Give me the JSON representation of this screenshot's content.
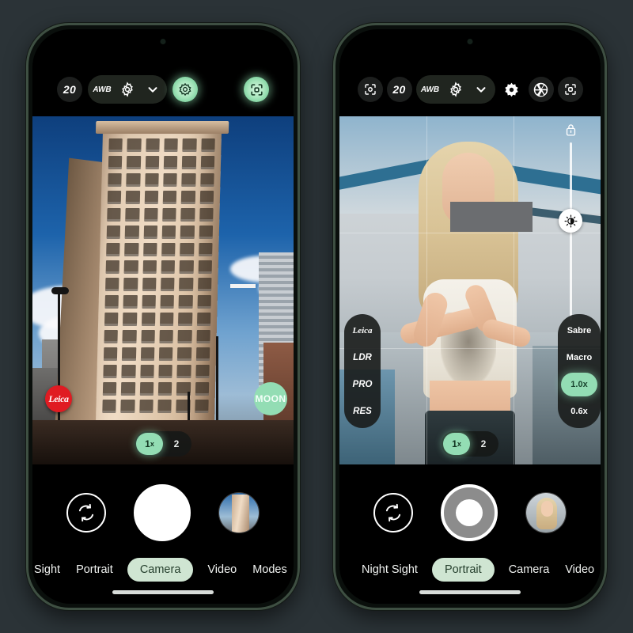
{
  "app": {
    "name": "Camera",
    "accent_green": "#93ddb4",
    "mode_pill_bg": "#cfe5d2",
    "leica_red": "#e01b22",
    "page_bg": "#2b3337",
    "phone_frame": "#3e4f42"
  },
  "phone1": {
    "topbar": [
      {
        "name": "iso-count",
        "label": "20",
        "type": "text-chip"
      },
      {
        "name": "white-balance",
        "label": "AWB",
        "type": "text-chip"
      },
      {
        "name": "settings-gear",
        "label": "",
        "type": "gear-icon"
      },
      {
        "name": "expand-chevron",
        "label": "",
        "type": "chevron-down-icon"
      },
      {
        "name": "filter-active",
        "label": "",
        "type": "flower-icon",
        "active": true
      },
      {
        "name": "scan-focus",
        "label": "",
        "type": "scan-icon",
        "active": true
      }
    ],
    "overlay": {
      "leica_badge": "Leica",
      "moon_badge": "MOON",
      "zoom_options": [
        {
          "label": "1",
          "suffix": "x",
          "active": true
        },
        {
          "label": "2",
          "suffix": "",
          "active": false
        }
      ]
    },
    "shutter": {
      "flip_label": "Flip camera",
      "shutter_label": "Shutter",
      "gallery_label": "Gallery"
    },
    "modes": [
      {
        "label": "Sight",
        "active": false
      },
      {
        "label": "Portrait",
        "active": false
      },
      {
        "label": "Camera",
        "active": true
      },
      {
        "label": "Video",
        "active": false
      },
      {
        "label": "Modes",
        "active": false
      }
    ]
  },
  "phone2": {
    "topbar": [
      {
        "name": "scan-focus-left",
        "label": "",
        "type": "scan-icon"
      },
      {
        "name": "iso-count",
        "label": "20",
        "type": "text-chip"
      },
      {
        "name": "white-balance",
        "label": "AWB",
        "type": "text-chip"
      },
      {
        "name": "settings-gear",
        "label": "",
        "type": "gear-icon"
      },
      {
        "name": "expand-chevron",
        "label": "",
        "type": "chevron-down-icon"
      },
      {
        "name": "filter-flower",
        "label": "",
        "type": "flower-icon"
      },
      {
        "name": "aperture",
        "label": "",
        "type": "aperture-icon"
      },
      {
        "name": "scan-focus-right",
        "label": "",
        "type": "scan-icon"
      }
    ],
    "overlay": {
      "exposure_lock": "AE lock",
      "exposure_label": "Exposure",
      "left_strip": [
        {
          "label": "Leica",
          "type": "logo",
          "active": false
        },
        {
          "label": "LDR",
          "active": false
        },
        {
          "label": "PRO",
          "active": false
        },
        {
          "label": "RES",
          "active": false
        }
      ],
      "right_strip": [
        {
          "label": "Sabre",
          "active": false
        },
        {
          "label": "Macro",
          "active": false
        },
        {
          "label": "1.0x",
          "active": true
        },
        {
          "label": "0.6x",
          "active": false
        }
      ],
      "zoom_options": [
        {
          "label": "1",
          "suffix": "x",
          "active": true
        },
        {
          "label": "2",
          "suffix": "",
          "active": false
        }
      ]
    },
    "shutter": {
      "flip_label": "Flip camera",
      "shutter_label": "Shutter",
      "gallery_label": "Gallery"
    },
    "modes": [
      {
        "label": "Night Sight",
        "active": false
      },
      {
        "label": "Portrait",
        "active": true
      },
      {
        "label": "Camera",
        "active": false
      },
      {
        "label": "Video",
        "active": false
      }
    ]
  }
}
